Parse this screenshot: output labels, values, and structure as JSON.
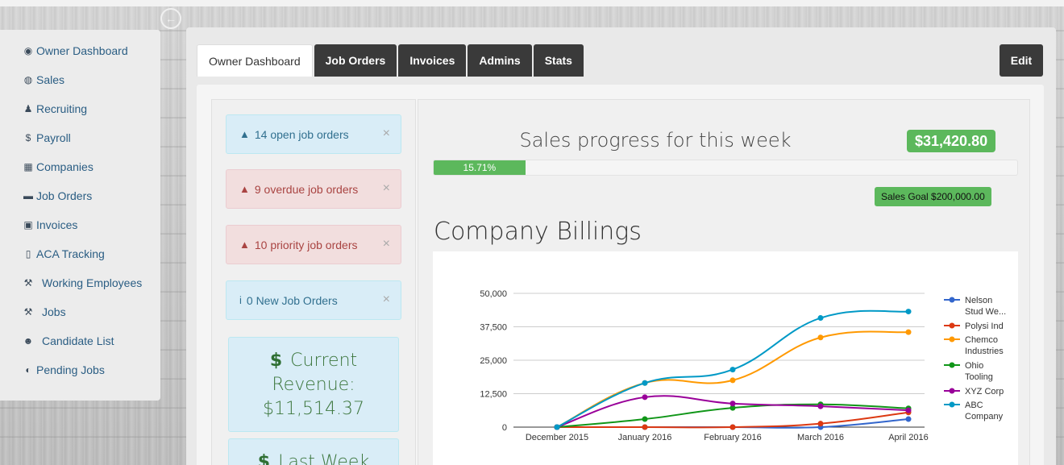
{
  "sidebar": {
    "items": [
      {
        "label": "Owner Dashboard",
        "icon": "dashboard-icon",
        "glyph": "◉"
      },
      {
        "label": "Sales",
        "icon": "globe-icon",
        "glyph": "◍"
      },
      {
        "label": "Recruiting",
        "icon": "user-tie-icon",
        "glyph": "♟"
      },
      {
        "label": "Payroll",
        "icon": "dollar-icon",
        "glyph": "$"
      },
      {
        "label": "Companies",
        "icon": "building-icon",
        "glyph": "▦"
      },
      {
        "label": "Job Orders",
        "icon": "briefcase-icon",
        "glyph": "▬"
      },
      {
        "label": "Invoices",
        "icon": "money-icon",
        "glyph": "▣"
      },
      {
        "label": "ACA Tracking",
        "icon": "file-icon",
        "glyph": "▯"
      },
      {
        "label": "Working Employees",
        "icon": "wrench-icon",
        "glyph": "⚒"
      },
      {
        "label": "Jobs",
        "icon": "wrench-icon",
        "glyph": "⚒"
      },
      {
        "label": "Candidate List",
        "icon": "users-icon",
        "glyph": "☻"
      },
      {
        "label": "Pending Jobs",
        "icon": "pause-circle-icon",
        "glyph": "◐"
      }
    ]
  },
  "tabs": [
    {
      "label": "Owner Dashboard",
      "active": true
    },
    {
      "label": "Job Orders",
      "active": false
    },
    {
      "label": "Invoices",
      "active": false
    },
    {
      "label": "Admins",
      "active": false
    },
    {
      "label": "Stats",
      "active": false
    }
  ],
  "edit_label": "Edit",
  "alerts": [
    {
      "text": "14 open job orders",
      "type": "info",
      "icon": "warning-icon",
      "glyph": "▲"
    },
    {
      "text": "9 overdue job orders",
      "type": "danger",
      "icon": "warning-icon",
      "glyph": "▲"
    },
    {
      "text": "10 priority job orders",
      "type": "danger",
      "icon": "warning-icon",
      "glyph": "▲"
    },
    {
      "text": "0 New Job Orders",
      "type": "info",
      "icon": "info-icon",
      "glyph": "i"
    }
  ],
  "revenue": {
    "current_label_1": "Current",
    "current_label_2": "Revenue:",
    "current_value": "$11,514.37",
    "last_week_label": "Last Week",
    "dollar": "$"
  },
  "sales": {
    "title": "Sales progress for this week",
    "amount": "$31,420.80",
    "progress_label": "15.71%",
    "progress_percent": 15.71,
    "goal_label": "Sales Goal  $200,000.00"
  },
  "billings_title": "Company Billings",
  "chart_data": {
    "type": "line",
    "categories": [
      "December 2015",
      "January 2016",
      "February 2016",
      "March 2016",
      "April 2016"
    ],
    "y_ticks": [
      "0",
      "12,500",
      "25,000",
      "37,500",
      "50,000"
    ],
    "ylim": [
      0,
      50000
    ],
    "grid": true,
    "legend_position": "right",
    "series": [
      {
        "name": "Nelson Stud We...",
        "legend_lines": [
          "Nelson",
          "Stud We..."
        ],
        "color": "#3366cc",
        "values": [
          0,
          0,
          0,
          0,
          3000
        ]
      },
      {
        "name": "Polysi Ind",
        "legend_lines": [
          "Polysi Ind"
        ],
        "color": "#dc3912",
        "values": [
          0,
          0,
          0,
          1300,
          5500
        ]
      },
      {
        "name": "Chemco Industries",
        "legend_lines": [
          "Chemco",
          "Industries"
        ],
        "color": "#ff9900",
        "values": [
          0,
          16500,
          17500,
          33500,
          35500
        ]
      },
      {
        "name": "Ohio Tooling",
        "legend_lines": [
          "Ohio",
          "Tooling"
        ],
        "color": "#109618",
        "values": [
          0,
          3000,
          7200,
          8500,
          7000
        ]
      },
      {
        "name": "XYZ Corp",
        "legend_lines": [
          "XYZ Corp"
        ],
        "color": "#990099",
        "values": [
          0,
          11200,
          8800,
          7800,
          6300
        ]
      },
      {
        "name": "ABC Company",
        "legend_lines": [
          "ABC",
          "Company"
        ],
        "color": "#0099c6",
        "values": [
          0,
          16500,
          21500,
          40800,
          43200
        ]
      }
    ]
  }
}
